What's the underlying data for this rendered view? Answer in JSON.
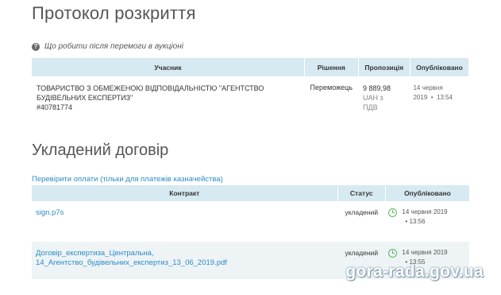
{
  "protocol": {
    "title": "Протокол розкриття",
    "help_link": "Що робити після перемоги в аукціоні",
    "headers": [
      "Учасник",
      "Рішення",
      "Пропозиція",
      "Опубліковано"
    ],
    "row": {
      "participant_line1": "ТОВАРИСТВО З ОБМЕЖЕНОЮ ВІДПОВІДАЛЬНІСТЮ \"АГЕНТСТВО",
      "participant_line2": "БУДІВЕЛЬНИХ ЕКСПЕРТИЗ\"",
      "participant_id": "#40781774",
      "decision": "Переможець",
      "amount": "9 889,98",
      "unit_line1": "UAH з",
      "unit_line2": "ПДВ",
      "published_date": "14 червня",
      "published_year": "2019",
      "published_sep": "•",
      "published_time": "13:54"
    }
  },
  "contract": {
    "title": "Укладений договір",
    "check_link": "Перевірити оплати (тільки для платежів казначейства)",
    "headers": [
      "Контракт",
      "Статус",
      "Опубліковано"
    ],
    "rows": [
      {
        "file_line1": "sign.p7s",
        "file_line2": "",
        "status": "укладений",
        "date": "14 червня 2019",
        "time": "• 13:56"
      },
      {
        "file_line1": "Договір_експертиза_Центральна,",
        "file_line2": "14_Агентство_будівельних_експертиз_13_06_2019.pdf",
        "status": "укладений",
        "date": "14 червня 2019",
        "time": "• 13:55"
      }
    ]
  },
  "watermark": "gora-rada.gov.ua",
  "colors": {
    "header_bg": "#d7eaf1",
    "link": "#2c8cc5",
    "clock": "#5cb85c"
  },
  "icons": {
    "help": "question-circle-icon",
    "published": "clock-icon"
  }
}
